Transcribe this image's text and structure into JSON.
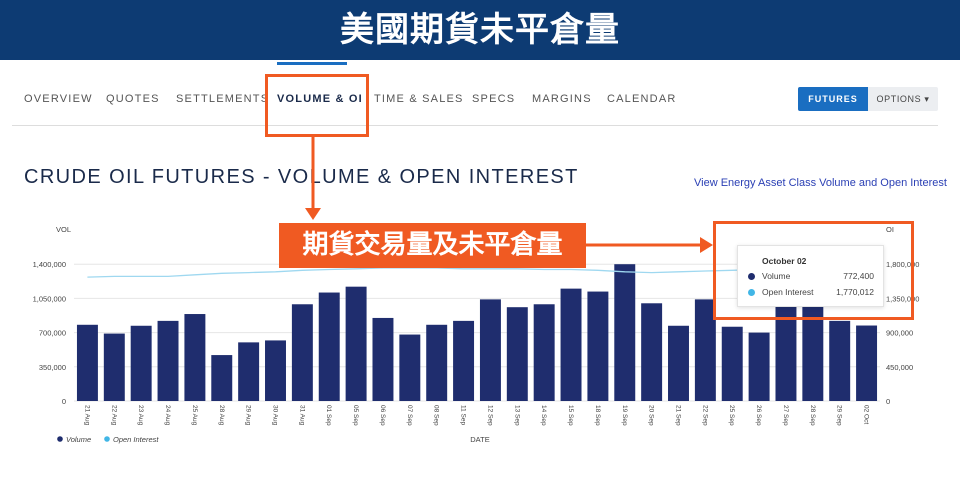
{
  "banner": {
    "title": "美國期貨未平倉量"
  },
  "nav": {
    "items": [
      "OVERVIEW",
      "QUOTES",
      "SETTLEMENTS",
      "VOLUME & OI",
      "TIME & SALES",
      "SPECS",
      "MARGINS",
      "CALENDAR"
    ],
    "active": "VOLUME & OI"
  },
  "toggle": {
    "futures": "FUTURES",
    "options": "OPTIONS ▾"
  },
  "page": {
    "title": "CRUDE OIL FUTURES - VOLUME & OPEN INTEREST",
    "link": "View Energy Asset Class Volume and Open Interest"
  },
  "callout": {
    "text": "期貨交易量及未平倉量"
  },
  "tooltip": {
    "date": "October 02",
    "rows": [
      {
        "label": "Volume",
        "value": "772,400",
        "color": "#1f2d6e"
      },
      {
        "label": "Open Interest",
        "value": "1,770,012",
        "color": "#41b6e6"
      }
    ]
  },
  "colors": {
    "accent": "#1a6ec1",
    "highlight": "#f05a22",
    "volume_bar": "#1f2d6e",
    "oi_line": "#9fd8f0",
    "oi_legend": "#41b6e6"
  },
  "chart_data": {
    "type": "bar",
    "title": "",
    "xlabel": "DATE",
    "ylabel": "VOL",
    "y2label": "OI",
    "ylim": [
      0,
      1750000
    ],
    "y2lim": [
      0,
      2250000
    ],
    "yticks": [
      "0",
      "350,000",
      "700,000",
      "1,050,000",
      "1,400,000"
    ],
    "y2ticks": [
      "0",
      "450,000",
      "900,000",
      "1,350,000",
      "1,800,000"
    ],
    "categories": [
      "21 Aug",
      "22 Aug",
      "23 Aug",
      "24 Aug",
      "25 Aug",
      "28 Aug",
      "29 Aug",
      "30 Aug",
      "31 Aug",
      "01 Sep",
      "05 Sep",
      "06 Sep",
      "07 Sep",
      "08 Sep",
      "11 Sep",
      "12 Sep",
      "13 Sep",
      "14 Sep",
      "15 Sep",
      "18 Sep",
      "19 Sep",
      "20 Sep",
      "21 Sep",
      "22 Sep",
      "25 Sep",
      "26 Sep",
      "27 Sep",
      "28 Sep",
      "29 Sep",
      "02 Oct"
    ],
    "series": [
      {
        "name": "Volume",
        "type": "bar",
        "values": [
          780000,
          690000,
          770000,
          820000,
          890000,
          470000,
          600000,
          620000,
          990000,
          1110000,
          1170000,
          850000,
          680000,
          780000,
          820000,
          1040000,
          960000,
          990000,
          1150000,
          1120000,
          1400000,
          1000000,
          770000,
          1040000,
          760000,
          700000,
          1080000,
          1010000,
          820000,
          772400
        ]
      },
      {
        "name": "Open Interest",
        "type": "line",
        "values": [
          1630000,
          1640000,
          1640000,
          1640000,
          1660000,
          1680000,
          1690000,
          1700000,
          1720000,
          1730000,
          1740000,
          1750000,
          1750000,
          1750000,
          1740000,
          1740000,
          1740000,
          1730000,
          1730000,
          1720000,
          1700000,
          1690000,
          1700000,
          1710000,
          1720000,
          1730000,
          1740000,
          1750000,
          1760000,
          1770012
        ]
      }
    ],
    "grid": true,
    "legend": "bottom-left"
  }
}
